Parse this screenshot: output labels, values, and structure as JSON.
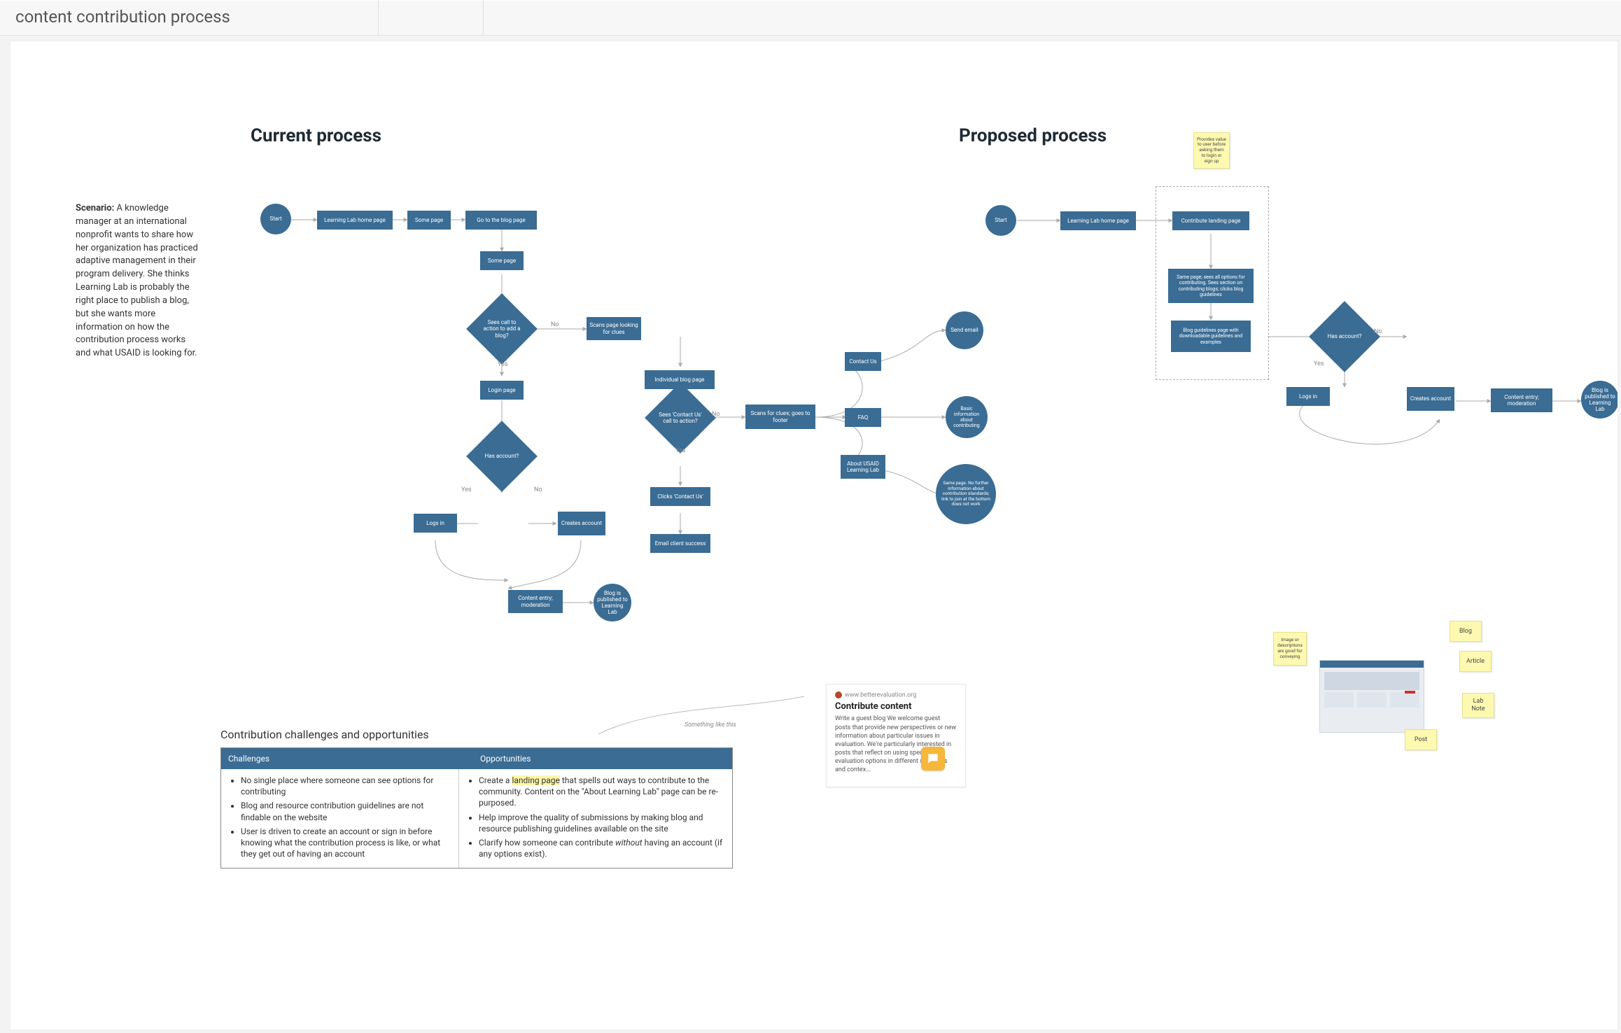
{
  "page": {
    "title": "content contribution process"
  },
  "headings": {
    "current": "Current process",
    "proposed": "Proposed process",
    "challenges_sub": "Contribution challenges and opportunities"
  },
  "scenario": {
    "label": "Scenario:",
    "body": " A knowledge manager at an international nonprofit wants to share how her organization has practiced adaptive management in their program delivery. She thinks Learning Lab is probably the right place to publish a blog, but she wants more information on how the contribution process works and what USAID is looking for."
  },
  "current_flow": {
    "start": "Start",
    "home": "Learning Lab home page",
    "some_page1": "Some page",
    "go_blog": "Go to the blog page",
    "some_page2": "Some page",
    "sees_cta": "Sees call to action to add a blog?",
    "scans_clues": "Scans page looking for clues",
    "individual_blog": "Individual blog page",
    "sees_contact": "Sees 'Contact Us' call to action?",
    "scans_footer": "Scans for clues; goes to footer",
    "clicks_contact": "Clicks 'Contact Us'",
    "email_success": "Email client success",
    "login_page": "Login page",
    "has_account": "Has account?",
    "logs_in": "Logs in",
    "creates_account": "Creates account",
    "content_entry": "Content entry; moderation",
    "blog_published": "Blog is published to Learning Lab",
    "contact_us": "Contact Us",
    "faq": "FAQ",
    "about": "About USAID Learning Lab",
    "send_email": "Send email",
    "basic_info": "Basic information about contributing",
    "same_page_footer": "Same page. No further information about contribution standards; link to join at the bottom does not work",
    "yes": "Yes",
    "no": "No"
  },
  "proposed_flow": {
    "start": "Start",
    "home": "Learning Lab home page",
    "contribute_landing": "Contribute landing page",
    "same_page_options": "Same page; sees all options for contributing. Sees section on contributing blogs; clicks blog guidelines",
    "blog_guidelines": "Blog guidelines page with downloadable guidelines and examples",
    "has_account": "Has account?",
    "logs_in": "Logs in",
    "creates_account": "Creates account",
    "content_entry": "Content entry; moderation",
    "blog_published": "Blog is published to Learning Lab",
    "sticky_value": "Provides value to user before asking them to login or sign up",
    "yes": "Yes",
    "no": "No"
  },
  "something_like_this": "Something like this",
  "card": {
    "url": "www.betterevaluation.org",
    "title": "Contribute content",
    "body": "Write a guest blog We welcome guest posts that provide new perspectives or new information about particular issues in evaluation. We're particularly interested in posts that reflect on using specific evaluation options in different situations and contex..."
  },
  "table": {
    "hdr_challenges": "Challenges",
    "hdr_opportunities": "Opportunities",
    "challenges": [
      "No single place where someone can see options for contributing",
      "Blog and resource contribution guidelines are not findable on the website",
      "User is driven to create an account or sign in before knowing what the contribution process is like, or what they get out of having an account"
    ],
    "opp1_pre": "Create a ",
    "opp1_hl": "landing page",
    "opp1_post": " that spells out ways to contribute to the community. Content on the \"About Learning Lab\" page can be re-purposed.",
    "opp2": "Help improve the quality of submissions by making blog and resource publishing guidelines available on the site",
    "opp3_pre": "Clarify how someone can contribute ",
    "opp3_em": "without",
    "opp3_post": " having an account (if any options exist)."
  },
  "right_stickies": {
    "image_desc": "Image or descriptions are good for conveying",
    "blog": "Blog",
    "article": "Article",
    "lab_note": "Lab Note",
    "post": "Post"
  }
}
